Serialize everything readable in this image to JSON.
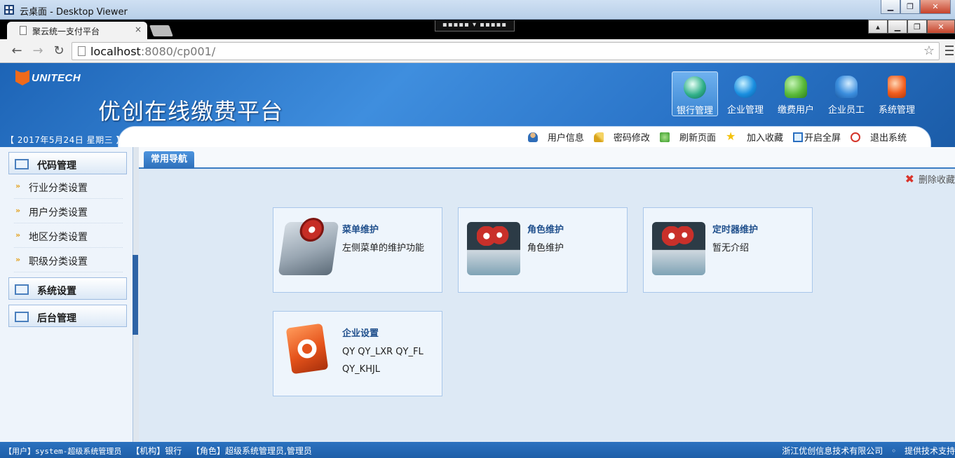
{
  "window": {
    "title": "云桌面 - Desktop Viewer",
    "minimize": "▁",
    "restore": "❐",
    "close": "✕"
  },
  "browser": {
    "tab_title": "聚云统一支付平台",
    "tab_close": "×",
    "remote_bar": "▪▪▪▪▪ ▾ ▪▪▪▪▪",
    "url_host": "localhost",
    "url_rest": ":8080/cp001/",
    "back": "←",
    "forward": "→",
    "reload": "↻",
    "star": "☆"
  },
  "header": {
    "logo_text": "UNITECH",
    "app_title": "优创在线缴费平台",
    "top_menu": [
      {
        "label": "银行管理",
        "icon": "bank-globe-icon",
        "active": true
      },
      {
        "label": "企业管理",
        "icon": "ie-icon",
        "active": false
      },
      {
        "label": "缴费用户",
        "icon": "users-icon",
        "active": false
      },
      {
        "label": "企业员工",
        "icon": "staff-icon",
        "active": false
      },
      {
        "label": "系统管理",
        "icon": "system-gear-icon",
        "active": false
      }
    ],
    "date": "【 2017年5月24日  星期三 】",
    "utilities": [
      {
        "label": "用户信息",
        "icon": "user-icon"
      },
      {
        "label": "密码修改",
        "icon": "key-icon"
      },
      {
        "label": "刷新页面",
        "icon": "refresh-icon"
      },
      {
        "label": "加入收藏",
        "icon": "star-icon",
        "glyph": "★"
      },
      {
        "label": "开启全屏",
        "icon": "fullscreen-icon"
      },
      {
        "label": "退出系统",
        "icon": "power-icon"
      }
    ]
  },
  "sidebar": {
    "groups": [
      {
        "label": "代码管理",
        "items": [
          "行业分类设置",
          "用户分类设置",
          "地区分类设置",
          "职级分类设置"
        ]
      },
      {
        "label": "系统设置"
      },
      {
        "label": "后台管理"
      }
    ],
    "arrow_glyph": "»"
  },
  "main": {
    "tab_label": "常用导航",
    "delete_fav": "删除收藏",
    "delete_glyph": "✖",
    "cards": [
      {
        "title": "菜单维护",
        "desc": "左侧菜单的维护功能",
        "icon": "menu-gear-disk-icon"
      },
      {
        "title": "角色维护",
        "desc": "角色维护",
        "icon": "console-gear-icon"
      },
      {
        "title": "定时器维护",
        "desc": "暂无介绍",
        "icon": "console-gear-icon"
      },
      {
        "title": "企业设置",
        "desc": "QY QY_LXR QY_FL QY_KHJL",
        "icon": "orange-gear-icon"
      }
    ]
  },
  "status": {
    "user": "【用户】system-超级系统管理员",
    "org": "【机构】银行",
    "role": "【角色】超级系统管理员,管理员",
    "company": "浙江优创信息技术有限公司",
    "dot": "◦",
    "support": "提供技术支持"
  }
}
